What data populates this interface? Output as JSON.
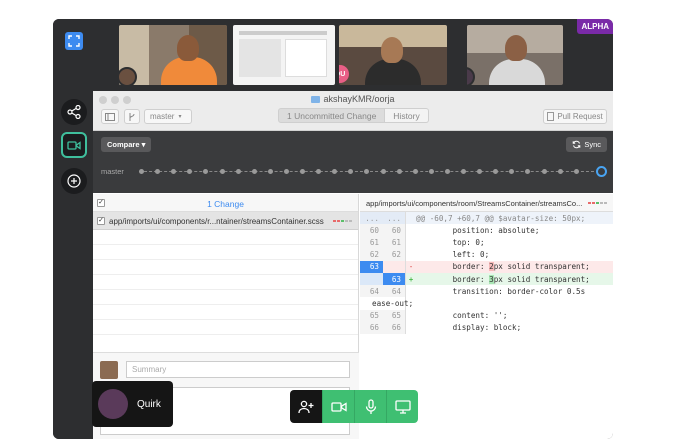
{
  "badge": "ALPHA",
  "participants": [
    {
      "initials": ""
    },
    {
      "initials": ""
    },
    {
      "initials": "QU"
    },
    {
      "initials": ""
    }
  ],
  "sidebar": {
    "items": [
      "share-icon",
      "video-call-icon",
      "add-icon"
    ]
  },
  "window": {
    "repo": "akshayKMR/oorja"
  },
  "toolbar": {
    "branch": "master",
    "tabs": [
      "1 Uncommitted Change",
      "History"
    ],
    "pull_request": "Pull Request"
  },
  "compare": {
    "label": "Compare ▾",
    "sync": "Sync",
    "branch_label": "master"
  },
  "changes": {
    "title": "1 Change",
    "files": [
      {
        "path": "app/imports/ui/components/r...ntainer/streamsContainer.scss"
      }
    ],
    "summary_placeholder": "Summary"
  },
  "diff": {
    "path": "app/imports/ui/components/room/StreamsContainer/streamsCo...",
    "hunk": "@@ -60,7 +60,7 @@ $avatar-size: 50px;",
    "lines": [
      {
        "old": "60",
        "new": "60",
        "mark": " ",
        "text": "        position: absolute;"
      },
      {
        "old": "61",
        "new": "61",
        "mark": " ",
        "text": "        top: 0;"
      },
      {
        "old": "62",
        "new": "62",
        "mark": " ",
        "text": "        left: 0;"
      },
      {
        "old": "63",
        "new": "",
        "mark": "-",
        "pre": "        border: ",
        "hl": "2",
        "post": "px solid transparent;"
      },
      {
        "old": "",
        "new": "63",
        "mark": "+",
        "pre": "        border: ",
        "hl": "3",
        "post": "px solid transparent;"
      },
      {
        "old": "64",
        "new": "64",
        "mark": " ",
        "text": "        transition: border-color 0.5s"
      },
      {
        "old": "",
        "new": "",
        "mark": "",
        "text": "ease-out;"
      },
      {
        "old": "65",
        "new": "65",
        "mark": " ",
        "text": "        content: '';"
      },
      {
        "old": "66",
        "new": "66",
        "mark": " ",
        "text": "        display: block;"
      }
    ]
  },
  "quirk": {
    "name": "Quirk"
  },
  "controls": [
    "add-person-icon",
    "video-icon",
    "microphone-icon",
    "screen-share-icon"
  ],
  "colors": {
    "accent": "#3d8bf0",
    "green": "#3fbf72",
    "alpha": "#7a2aa8",
    "teal": "#3fbf9d"
  }
}
